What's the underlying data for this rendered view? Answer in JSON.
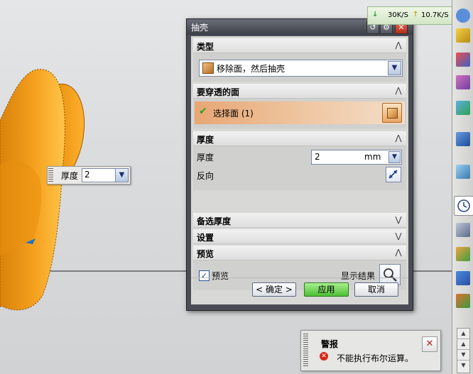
{
  "dialog": {
    "title": "抽壳",
    "sections": {
      "type": {
        "title": "类型",
        "selected": "移除面，然后抽壳"
      },
      "face": {
        "title": "要穿透的面",
        "select_label": "选择面 (1)"
      },
      "thickness": {
        "title": "厚度",
        "label": "厚度",
        "value": "2",
        "unit": "mm",
        "reverse_label": "反向"
      },
      "alt_thickness": {
        "title": "备选厚度"
      },
      "settings": {
        "title": "设置"
      },
      "preview": {
        "title": "预览",
        "check_label": "预览",
        "checked": true,
        "show_result_label": "显示结果"
      }
    },
    "buttons": {
      "ok": "< 确定 >",
      "apply": "应用",
      "cancel": "取消"
    }
  },
  "floating_input": {
    "label": "厚度",
    "value": "2"
  },
  "network": {
    "down": "30K/S",
    "up": "10.7K/S"
  },
  "alert": {
    "title": "警报",
    "message": "不能执行布尔运算。"
  },
  "icons": {
    "reset": "reset-icon",
    "settings": "gear-icon",
    "close": "close-icon",
    "collapse": "chevron-up-icon",
    "expand": "chevron-down-icon",
    "check": "check-icon",
    "face_pick": "cube-icon",
    "reverse": "reverse-direction-icon",
    "magnifier": "magnifier-icon",
    "error": "error-icon"
  },
  "colors": {
    "part": "#f5a01e",
    "apply": "#4dbf33",
    "select_face_bg": "#e8a674"
  }
}
